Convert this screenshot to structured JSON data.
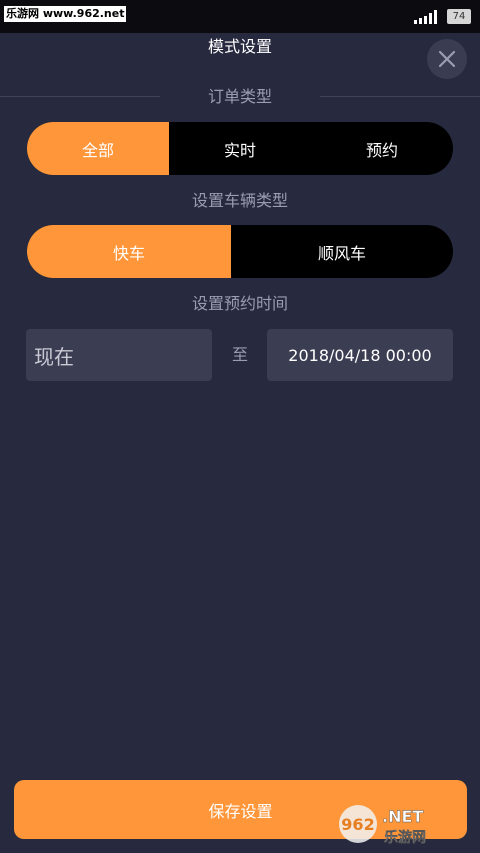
{
  "status_bar": {
    "watermark": "乐游网 www.962.net",
    "battery": "74"
  },
  "header": {
    "title": "模式设置"
  },
  "order_type": {
    "label": "订单类型",
    "options": [
      "全部",
      "实时",
      "预约"
    ],
    "selected": "全部"
  },
  "vehicle_type": {
    "label": "设置车辆类型",
    "options": [
      "快车",
      "顺风车"
    ],
    "selected": "快车"
  },
  "reservation_time": {
    "label": "设置预约时间",
    "start": "现在",
    "separator": "至",
    "end": "2018/04/18 00:00"
  },
  "footer": {
    "save_label": "保存设置"
  },
  "watermark_logo": {
    "brand_number": "962",
    "brand_suffix": ".NET",
    "brand_cn": "乐游网"
  },
  "colors": {
    "accent": "#ff973a",
    "background": "#272a3f",
    "segment_bg": "#000000",
    "field_bg": "#3b3d52"
  }
}
